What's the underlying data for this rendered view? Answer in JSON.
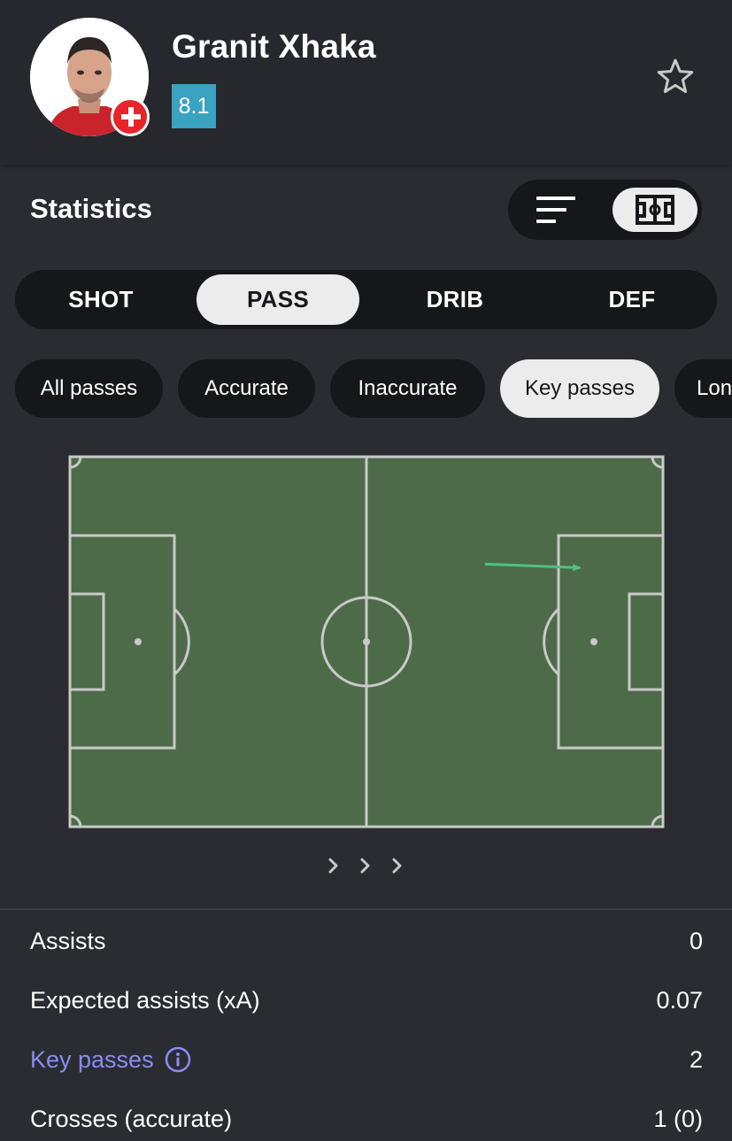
{
  "player": {
    "name": "Granit Xhaka",
    "rating": "8.1",
    "rating_color": "#3aa3c1",
    "nationality_flag_icon": "switzerland-flag-icon"
  },
  "statistics": {
    "title": "Statistics",
    "view_modes": [
      "list-view-icon",
      "pitch-view-icon"
    ],
    "active_view": "pitch-view-icon"
  },
  "category_tabs": [
    {
      "label": "SHOT",
      "active": false
    },
    {
      "label": "PASS",
      "active": true
    },
    {
      "label": "DRIB",
      "active": false
    },
    {
      "label": "DEF",
      "active": false
    }
  ],
  "filter_chips": [
    {
      "label": "All passes",
      "active": false
    },
    {
      "label": "Accurate",
      "active": false
    },
    {
      "label": "Inaccurate",
      "active": false
    },
    {
      "label": "Key passes",
      "active": true
    },
    {
      "label": "Lon",
      "active": false
    }
  ],
  "pitch": {
    "color": "#4d6b48",
    "line_color": "#c9c9c9",
    "pass_color": "#4fc27f",
    "key_passes": [
      {
        "from": [
          0.7,
          0.29
        ],
        "to": [
          0.86,
          0.3
        ]
      }
    ]
  },
  "stats": [
    {
      "label": "Assists",
      "value": "0",
      "link": false
    },
    {
      "label": "Expected assists (xA)",
      "value": "0.07",
      "link": false
    },
    {
      "label": "Key passes",
      "value": "2",
      "link": true
    },
    {
      "label": "Crosses (accurate)",
      "value": "1 (0)",
      "link": false
    }
  ]
}
